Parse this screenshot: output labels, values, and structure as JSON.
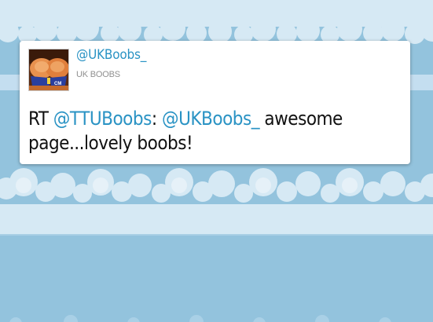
{
  "colors": {
    "background": "#93c3dd",
    "cloud": "#d6e9f4",
    "link": "#2a93c4",
    "card": "#ffffff"
  },
  "tweet": {
    "avatar_icon": "user-avatar-image",
    "user_handle": "@UKBoobs_",
    "display_name": "UK BOOBS",
    "text_prefix": "RT ",
    "mention_1": "@TTUBoobs",
    "separator": ": ",
    "mention_2": "@UKBoobs_",
    "text_suffix": " awesome page...lovely boobs!"
  }
}
